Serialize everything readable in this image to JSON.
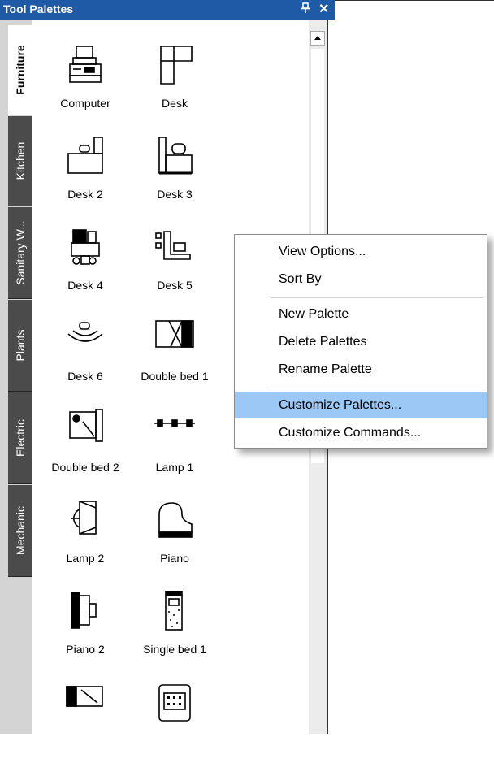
{
  "window": {
    "title": "Tool Palettes",
    "pin_glyph": "ᵖ",
    "close_glyph": "✕"
  },
  "tabs": [
    {
      "label": "Furniture",
      "active": true
    },
    {
      "label": "Kitchen",
      "active": false
    },
    {
      "label": "Sanitary W...",
      "active": false
    },
    {
      "label": "Plants",
      "active": false
    },
    {
      "label": "Electric",
      "active": false
    },
    {
      "label": "Mechanic",
      "active": false
    }
  ],
  "items": [
    {
      "label": "Computer",
      "icon": "computer-icon"
    },
    {
      "label": "Desk",
      "icon": "desk-icon"
    },
    {
      "label": "Desk 2",
      "icon": "desk2-icon"
    },
    {
      "label": "Desk 3",
      "icon": "desk3-icon"
    },
    {
      "label": "Desk 4",
      "icon": "desk4-icon"
    },
    {
      "label": "Desk 5",
      "icon": "desk5-icon"
    },
    {
      "label": "Desk 6",
      "icon": "desk6-icon"
    },
    {
      "label": "Double bed 1",
      "icon": "double-bed1-icon"
    },
    {
      "label": "Double bed 2",
      "icon": "double-bed2-icon"
    },
    {
      "label": "Lamp 1",
      "icon": "lamp1-icon"
    },
    {
      "label": "Lamp 2",
      "icon": "lamp2-icon"
    },
    {
      "label": "Piano",
      "icon": "piano-icon"
    },
    {
      "label": "Piano 2",
      "icon": "piano2-icon"
    },
    {
      "label": "Single bed 1",
      "icon": "single-bed1-icon"
    },
    {
      "label": "",
      "icon": "bed-icon"
    },
    {
      "label": "",
      "icon": "stove-icon"
    }
  ],
  "context_menu": {
    "items": [
      {
        "label": "View Options..."
      },
      {
        "label": "Sort By"
      },
      {
        "label": "New Palette"
      },
      {
        "label": "Delete Palettes"
      },
      {
        "label": "Rename Palette"
      },
      {
        "label": "Customize Palettes...",
        "highlighted": true
      },
      {
        "label": "Customize Commands..."
      }
    ]
  },
  "colors": {
    "titlebar": "#1f5aa6",
    "tab_inactive": "#4b4b4b",
    "menu_highlight": "#9cc8f5"
  }
}
